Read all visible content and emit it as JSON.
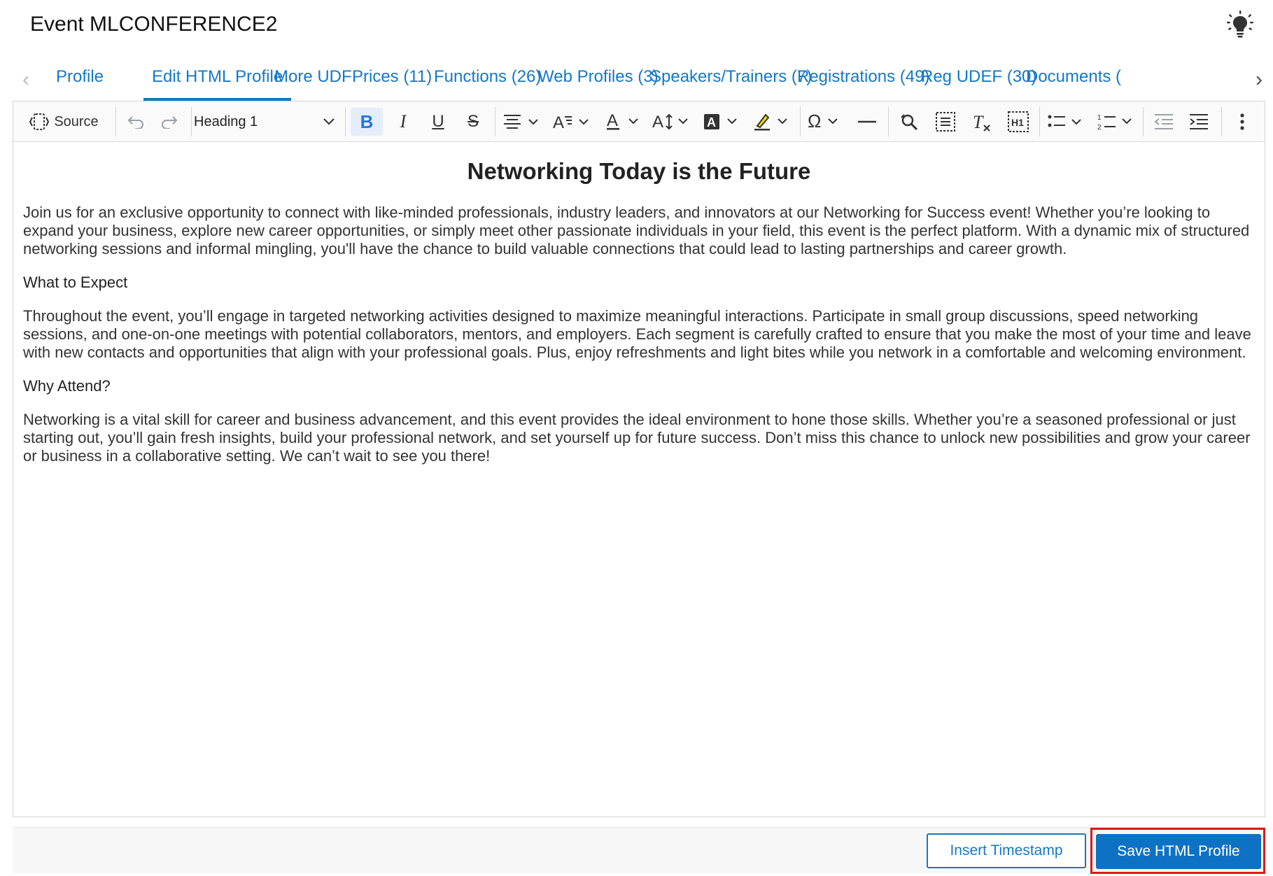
{
  "header": {
    "title": "Event MLCONFERENCE2",
    "icon": "lightbulb-icon"
  },
  "tabs": [
    {
      "label": "Profile",
      "active": false
    },
    {
      "label": "Edit HTML Profile",
      "active": true
    },
    {
      "label": "More UDF",
      "active": false
    },
    {
      "label": "Prices (11)",
      "active": false
    },
    {
      "label": "Functions (26)",
      "active": false
    },
    {
      "label": "Web Profiles (3)",
      "active": false
    },
    {
      "label": "Speakers/Trainers (7)",
      "active": false
    },
    {
      "label": "Registrations (49)",
      "active": false
    },
    {
      "label": "Reg UDEF (30)",
      "active": false
    },
    {
      "label": "Documents (",
      "active": false
    }
  ],
  "toolbar": {
    "source_label": "Source",
    "heading_value": "Heading 1"
  },
  "content": {
    "heading": "Networking Today is the Future",
    "intro": "Join us for an exclusive opportunity to connect with like-minded professionals, industry leaders, and innovators at our Networking for Success event! Whether you’re looking to expand your business, explore new career opportunities, or simply meet other passionate individuals in your field, this event is the perfect platform. With a dynamic mix of structured networking sessions and informal mingling, you'll have the chance to build valuable connections that could lead to lasting partnerships and career growth.",
    "section1_title": "What to Expect",
    "section1_body": "Throughout the event, you’ll engage in targeted networking activities designed to maximize meaningful interactions. Participate in small group discussions, speed networking sessions, and one-on-one meetings with potential collaborators, mentors, and employers. Each segment is carefully crafted to ensure that you make the most of your time and leave with new contacts and opportunities that align with your professional goals. Plus, enjoy refreshments and light bites while you network in a comfortable and welcoming environment.",
    "section2_title": "Why Attend?",
    "section2_body": "Networking is a vital skill for career and business advancement, and this event provides the ideal environment to hone those skills. Whether you’re a seasoned professional or just starting out, you’ll gain fresh insights, build your professional network, and set yourself up for future success. Don’t miss this chance to unlock new possibilities and grow your career or business in a collaborative setting. We can’t wait to see you there!"
  },
  "footer": {
    "insert_timestamp_label": "Insert Timestamp",
    "save_label": "Save HTML Profile"
  },
  "colors": {
    "accent": "#1478c8",
    "primary_button": "#0d72c4",
    "highlight_border": "#e01818"
  }
}
